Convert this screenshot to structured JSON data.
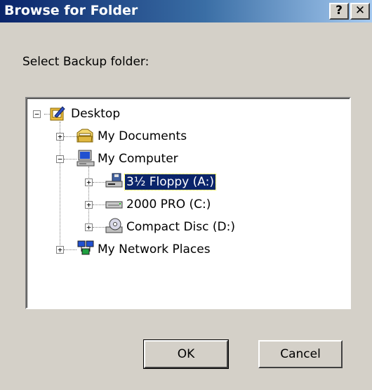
{
  "window": {
    "title": "Browse for Folder",
    "help_label": "?",
    "close_label": "✕"
  },
  "prompt": "Select Backup folder:",
  "tree": {
    "desktop": {
      "label": "Desktop",
      "expander": "−",
      "icon": "desktop-icon"
    },
    "my_documents": {
      "label": "My Documents",
      "expander": "+",
      "icon": "folder-documents-icon"
    },
    "my_computer": {
      "label": "My Computer",
      "expander": "−",
      "icon": "computer-icon"
    },
    "floppy": {
      "label": "3½ Floppy (A:)",
      "expander": "+",
      "icon": "floppy-drive-icon",
      "selected": true
    },
    "c_drive": {
      "label": "2000 PRO (C:)",
      "expander": "+",
      "icon": "hard-drive-icon"
    },
    "d_drive": {
      "label": "Compact Disc (D:)",
      "expander": "+",
      "icon": "cd-drive-icon"
    },
    "network": {
      "label": "My Network Places",
      "expander": "+",
      "icon": "network-places-icon"
    }
  },
  "buttons": {
    "ok": "OK",
    "cancel": "Cancel"
  },
  "colors": {
    "face": "#d4d0c8",
    "selection": "#0a246a",
    "title_start": "#0a246a",
    "title_end": "#a6caf0"
  }
}
